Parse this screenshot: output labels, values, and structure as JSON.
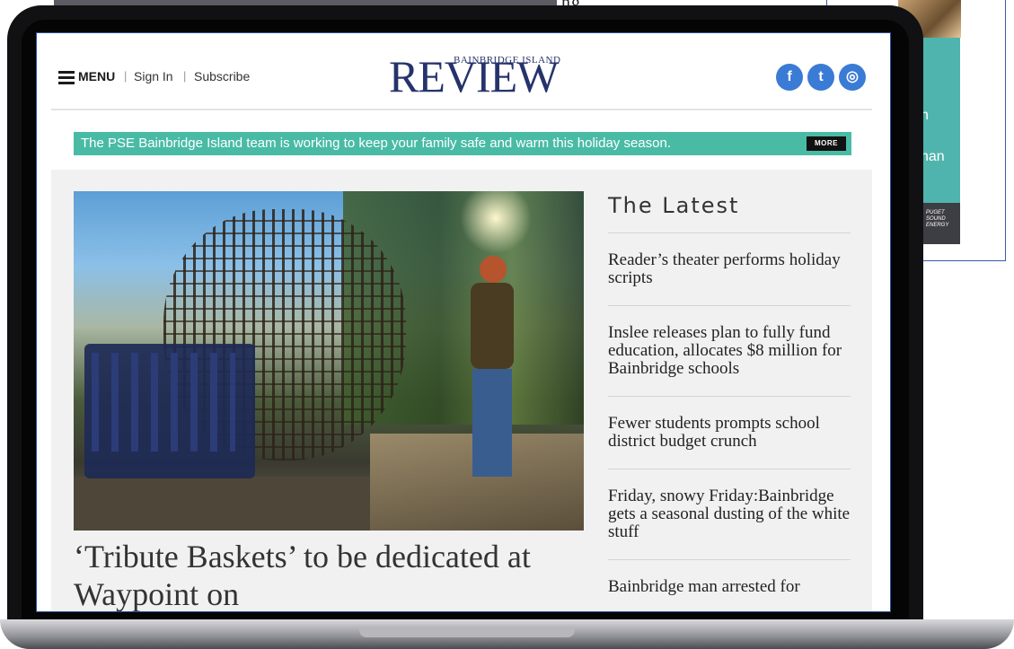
{
  "background": {
    "top_text": "ng",
    "ad_text_1": "n",
    "ad_text_2": "nan",
    "ad_brand": "PUGET SOUND ENERGY"
  },
  "header": {
    "menu_label": "MENU",
    "sign_in": "Sign In",
    "subscribe": "Subscribe",
    "logo_small": "BAINBRIDGE ISLAND",
    "logo_big": "REVIEW",
    "social": [
      {
        "name": "facebook",
        "glyph": "f"
      },
      {
        "name": "twitter",
        "glyph": "t"
      },
      {
        "name": "instagram",
        "glyph": "◎"
      }
    ]
  },
  "banner": {
    "text": "The PSE Bainbridge Island team is working to keep your family safe and warm this holiday season.",
    "more": "MORE"
  },
  "hero": {
    "image_icon": "photo",
    "headline": "‘Tribute Baskets’ to be dedicated at Waypoint on"
  },
  "latest": {
    "title": "The Latest",
    "items": [
      "Reader’s theater performs holiday scripts",
      "Inslee releases plan to fully fund education, allocates $8 million for Bainbridge schools",
      "Fewer students prompts school district budget crunch",
      "Friday, snowy Friday:Bainbridge gets a seasonal dusting of the white stuff",
      "Bainbridge man arrested for"
    ]
  },
  "colors": {
    "banner": "#49bba5",
    "logo": "#26336b",
    "social": "#3a7bd5"
  }
}
